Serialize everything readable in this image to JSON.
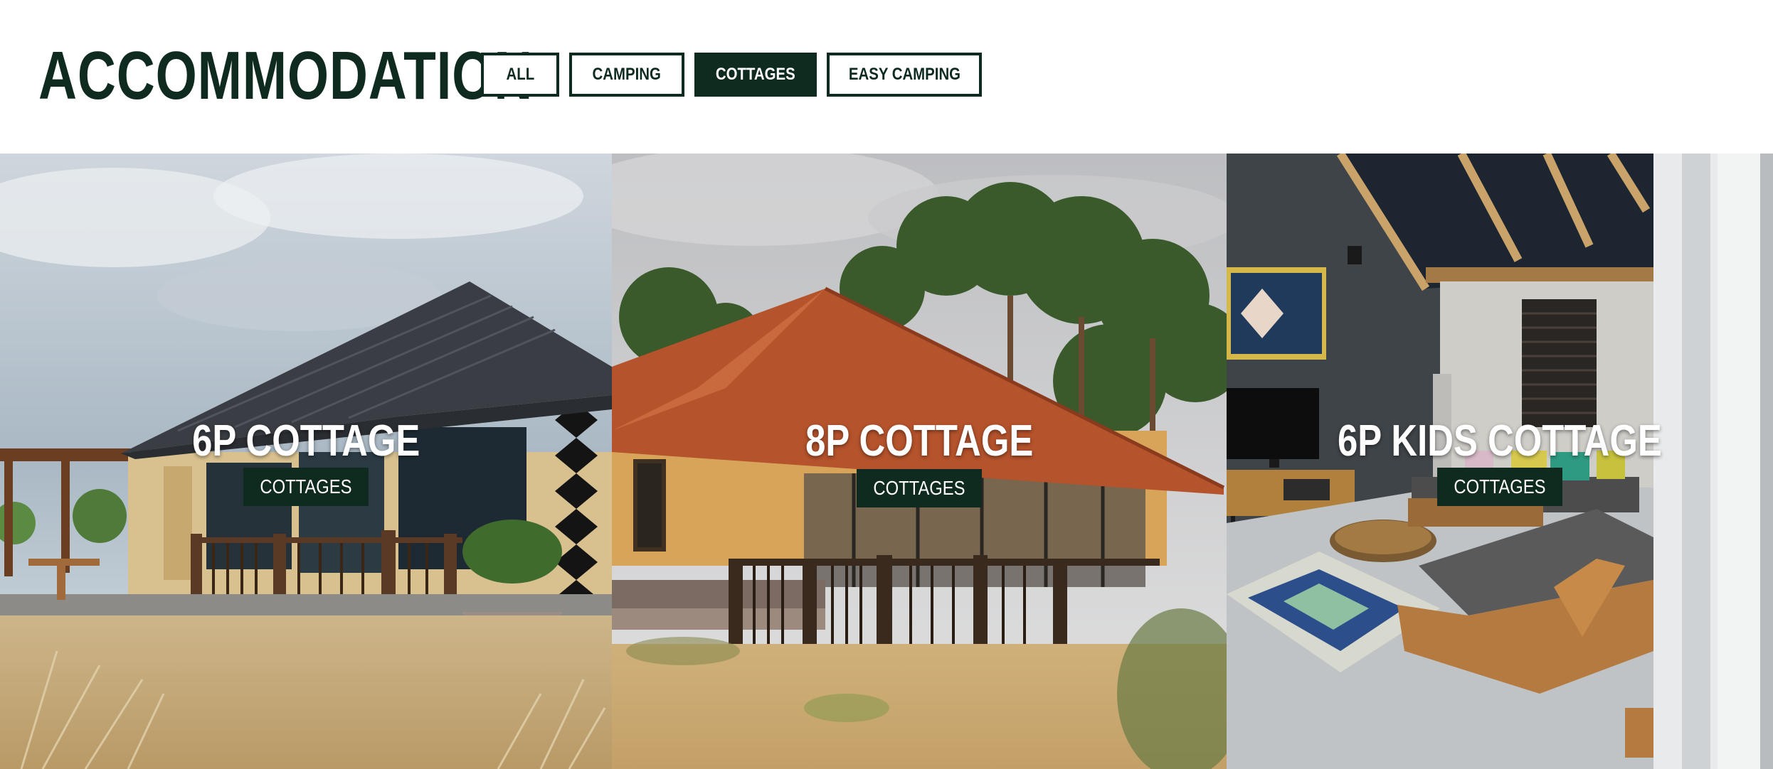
{
  "header": {
    "title": "ACCOMMODATION"
  },
  "filters": [
    {
      "label": "ALL",
      "active": false
    },
    {
      "label": "CAMPING",
      "active": false
    },
    {
      "label": "COTTAGES",
      "active": true
    },
    {
      "label": "EASY CAMPING",
      "active": false
    }
  ],
  "cards": [
    {
      "title": "6P COTTAGE",
      "category": "COTTAGES"
    },
    {
      "title": "8P COTTAGE",
      "category": "COTTAGES"
    },
    {
      "title": "6P KIDS COTTAGE",
      "category": "COTTAGES"
    }
  ],
  "colors": {
    "brand_dark_green": "#0f2b20",
    "background": "#ffffff",
    "label_text": "#ffffff"
  }
}
